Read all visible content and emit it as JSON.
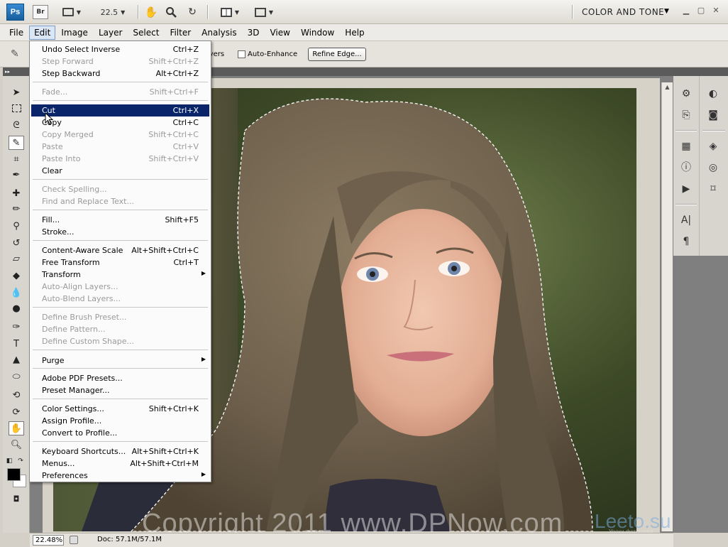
{
  "app": {
    "logo": "Ps",
    "bridge_label": "Br",
    "zoom_dropdown": "22.5",
    "workspace": "COLOR AND TONE"
  },
  "menubar": [
    "File",
    "Edit",
    "Image",
    "Layer",
    "Select",
    "Filter",
    "Analysis",
    "3D",
    "View",
    "Window",
    "Help"
  ],
  "options": {
    "sample_label": "Layers",
    "auto_enhance": "Auto-Enhance",
    "refine_edge": "Refine Edge..."
  },
  "edit_menu": {
    "undo": {
      "label": "Undo Select Inverse",
      "shortcut": "Ctrl+Z"
    },
    "step_forward": {
      "label": "Step Forward",
      "shortcut": "Shift+Ctrl+Z"
    },
    "step_backward": {
      "label": "Step Backward",
      "shortcut": "Alt+Ctrl+Z"
    },
    "fade": {
      "label": "Fade...",
      "shortcut": "Shift+Ctrl+F"
    },
    "cut": {
      "label": "Cut",
      "shortcut": "Ctrl+X"
    },
    "copy": {
      "label": "Copy",
      "shortcut": "Ctrl+C"
    },
    "copy_merged": {
      "label": "Copy Merged",
      "shortcut": "Shift+Ctrl+C"
    },
    "paste": {
      "label": "Paste",
      "shortcut": "Ctrl+V"
    },
    "paste_into": {
      "label": "Paste Into",
      "shortcut": "Shift+Ctrl+V"
    },
    "clear": {
      "label": "Clear"
    },
    "check_spelling": {
      "label": "Check Spelling..."
    },
    "find_replace": {
      "label": "Find and Replace Text..."
    },
    "fill": {
      "label": "Fill...",
      "shortcut": "Shift+F5"
    },
    "stroke": {
      "label": "Stroke..."
    },
    "content_aware_scale": {
      "label": "Content-Aware Scale",
      "shortcut": "Alt+Shift+Ctrl+C"
    },
    "free_transform": {
      "label": "Free Transform",
      "shortcut": "Ctrl+T"
    },
    "transform": {
      "label": "Transform"
    },
    "auto_align": {
      "label": "Auto-Align Layers..."
    },
    "auto_blend": {
      "label": "Auto-Blend Layers..."
    },
    "define_brush": {
      "label": "Define Brush Preset..."
    },
    "define_pattern": {
      "label": "Define Pattern..."
    },
    "define_shape": {
      "label": "Define Custom Shape..."
    },
    "purge": {
      "label": "Purge"
    },
    "pdf_presets": {
      "label": "Adobe PDF Presets..."
    },
    "preset_manager": {
      "label": "Preset Manager..."
    },
    "color_settings": {
      "label": "Color Settings...",
      "shortcut": "Shift+Ctrl+K"
    },
    "assign_profile": {
      "label": "Assign Profile..."
    },
    "convert_profile": {
      "label": "Convert to Profile..."
    },
    "keyboard_shortcuts": {
      "label": "Keyboard Shortcuts...",
      "shortcut": "Alt+Shift+Ctrl+K"
    },
    "menus": {
      "label": "Menus...",
      "shortcut": "Alt+Shift+Ctrl+M"
    },
    "preferences": {
      "label": "Preferences"
    }
  },
  "status": {
    "zoom": "22.48%",
    "doc": "Doc: 57.1M/57.1M"
  },
  "watermark": {
    "copyright": "Copyright 2011 www.DPNow.com",
    "site_logo": "Leeto.su",
    "site_tagline": "Уроки фотошопа"
  },
  "colors": {
    "menu_highlight": "#0a246a",
    "workspace_bg": "#7f7f7f",
    "panel_bg": "#d8d5cf"
  }
}
